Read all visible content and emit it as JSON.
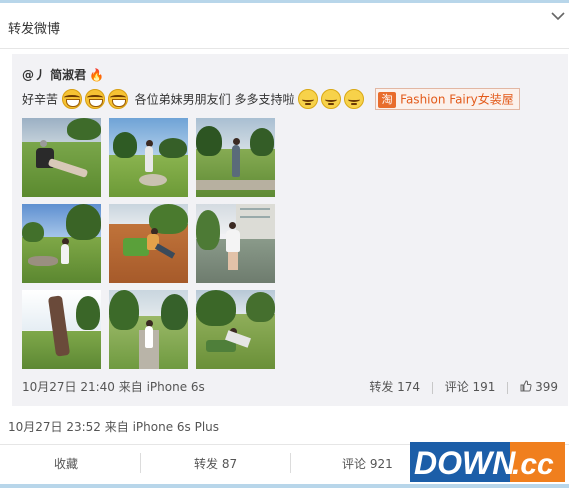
{
  "header": {
    "title": "转发微博"
  },
  "repost": {
    "author": "@丿 简淑君",
    "content_text": "好辛苦",
    "content_text2": "各位弟妹男朋友们 多多支持啦",
    "tag_icon": "淘",
    "tag_label": "Fashion Fairy女装屋",
    "time_source": "10月27日 21:40 来自 iPhone 6s",
    "actions": {
      "repost": "转发 174",
      "comment": "评论 191",
      "like": "399"
    }
  },
  "outer": {
    "time_source": "10月27日 23:52 来自 iPhone 6s Plus"
  },
  "bottom_bar": {
    "favorite": "收藏",
    "repost": "转发 87",
    "comment": "评论 921"
  },
  "watermark": {
    "text": "DOWN.cc"
  },
  "icons": {
    "chevron": "chevron-down-icon",
    "thumb": "thumbs-up-icon",
    "emoji_laugh": "laugh-emoji",
    "emoji_meh": "meh-emoji"
  },
  "colors": {
    "accent_orange": "#e35b1b",
    "watermark_blue": "#1c5ea8",
    "watermark_orange": "#f07f1e"
  }
}
